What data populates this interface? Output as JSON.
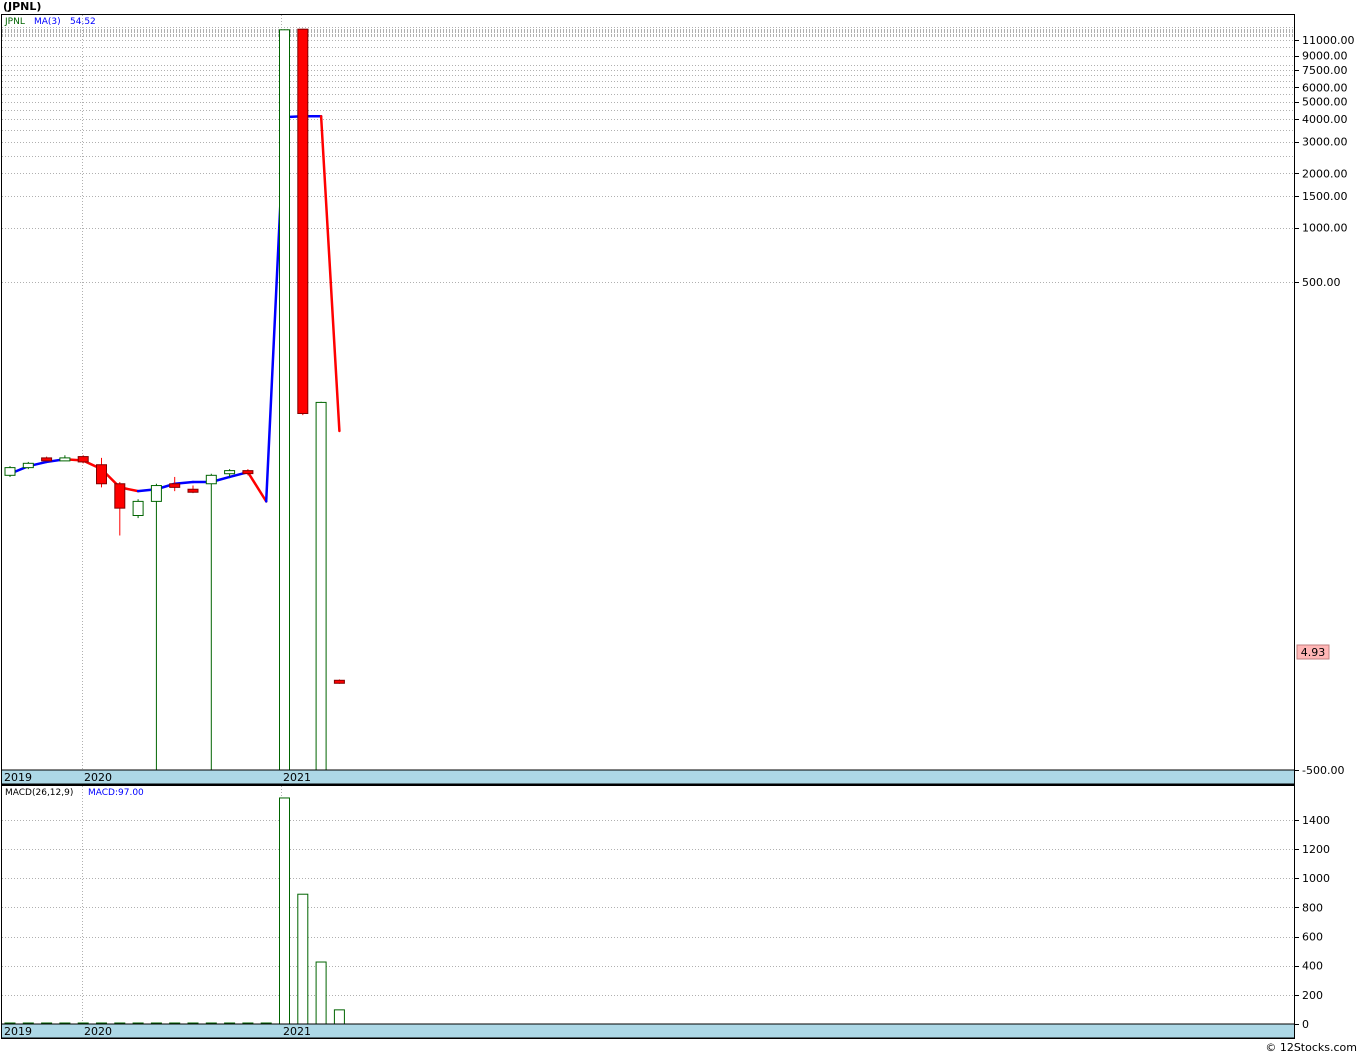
{
  "header": {
    "title": "(JPNL)"
  },
  "legend": {
    "symbol": "JPNL",
    "ma_label": "MA(3)",
    "ma_value": "54.52",
    "macd_label": "MACD(26,12,9)",
    "macd_value_label": "MACD:97.00"
  },
  "colors": {
    "up": "#006400",
    "down": "#ff0000",
    "ma_rising": "#0000ff",
    "ma_falling": "#ff0000",
    "axis_band": "#add8e6",
    "price_tag": "#ffb6b6",
    "grid": "#b0b0b0"
  },
  "copyright": "© 12Stocks.com",
  "last_price_label": "4.93",
  "chart_data": [
    {
      "type": "candlestick",
      "title": "(JPNL)",
      "y_scale": "log",
      "ylim": [
        -500,
        13000
      ],
      "y_tick_labels": [
        "11000.00",
        "9000.00",
        "7500.00",
        "6000.00",
        "5000.00",
        "4000.00",
        "3000.00",
        "2000.00",
        "1500.00",
        "1000.00",
        "500.00",
        "-500.00"
      ],
      "x_tick_labels": [
        "2019",
        "2020",
        "2021"
      ],
      "grid": true,
      "candles": [
        {
          "dir": "up",
          "open": 54,
          "close": 59,
          "high": 60,
          "low": 53
        },
        {
          "dir": "up",
          "open": 59,
          "close": 62,
          "high": 63,
          "low": 58
        },
        {
          "dir": "down",
          "open": 66,
          "close": 65,
          "high": 67,
          "low": 64
        },
        {
          "dir": "up",
          "open": 65,
          "close": 66,
          "high": 68,
          "low": 64
        },
        {
          "dir": "down",
          "open": 67,
          "close": 63,
          "high": 68,
          "low": 62
        },
        {
          "dir": "down",
          "open": 61,
          "close": 49,
          "high": 66,
          "low": 47
        },
        {
          "dir": "down",
          "open": 49,
          "close": 37,
          "high": 50,
          "low": 27
        },
        {
          "dir": "up",
          "open": 34,
          "close": 40,
          "high": 41,
          "low": 33
        },
        {
          "dir": "up",
          "open": 40,
          "close": 48,
          "high": 49,
          "low": 1
        },
        {
          "dir": "down",
          "open": 49,
          "close": 47,
          "high": 53,
          "low": 45
        },
        {
          "dir": "down",
          "open": 46,
          "close": 45,
          "high": 48,
          "low": 44
        },
        {
          "dir": "up",
          "open": 49,
          "close": 54,
          "high": 55,
          "low": 1
        },
        {
          "dir": "up",
          "open": 55,
          "close": 57,
          "high": 58,
          "low": 53
        },
        {
          "dir": "down",
          "open": 57,
          "close": 56,
          "high": 58,
          "low": 54
        },
        null,
        {
          "dir": "up",
          "open": 1,
          "close": 12500,
          "high": 12500,
          "low": 1
        },
        {
          "dir": "down",
          "open": 12600,
          "close": 110,
          "high": 12700,
          "low": 108
        },
        {
          "dir": "up",
          "open": 1,
          "close": 125,
          "high": 126,
          "low": 1
        },
        {
          "dir": "down",
          "open": 5.1,
          "close": 4.93,
          "high": 5.15,
          "low": 4.9
        }
      ],
      "ma3": [
        55,
        60,
        63,
        65,
        64,
        58,
        47,
        45,
        46,
        49,
        50,
        50,
        53,
        56,
        40,
        4100,
        4150,
        4150,
        90
      ]
    },
    {
      "type": "bar",
      "title": "MACD(26,12,9)",
      "ylim": [
        0,
        1560
      ],
      "y_tick_labels": [
        "1400",
        "1200",
        "1000",
        "800",
        "600",
        "400",
        "200",
        "0"
      ],
      "x_tick_labels": [
        "2019",
        "2020",
        "2021"
      ],
      "grid": true,
      "values": [
        0,
        0,
        0,
        0,
        0,
        0,
        0,
        0,
        0,
        0,
        0,
        0,
        0,
        0,
        0,
        1550,
        890,
        425,
        97
      ]
    }
  ]
}
